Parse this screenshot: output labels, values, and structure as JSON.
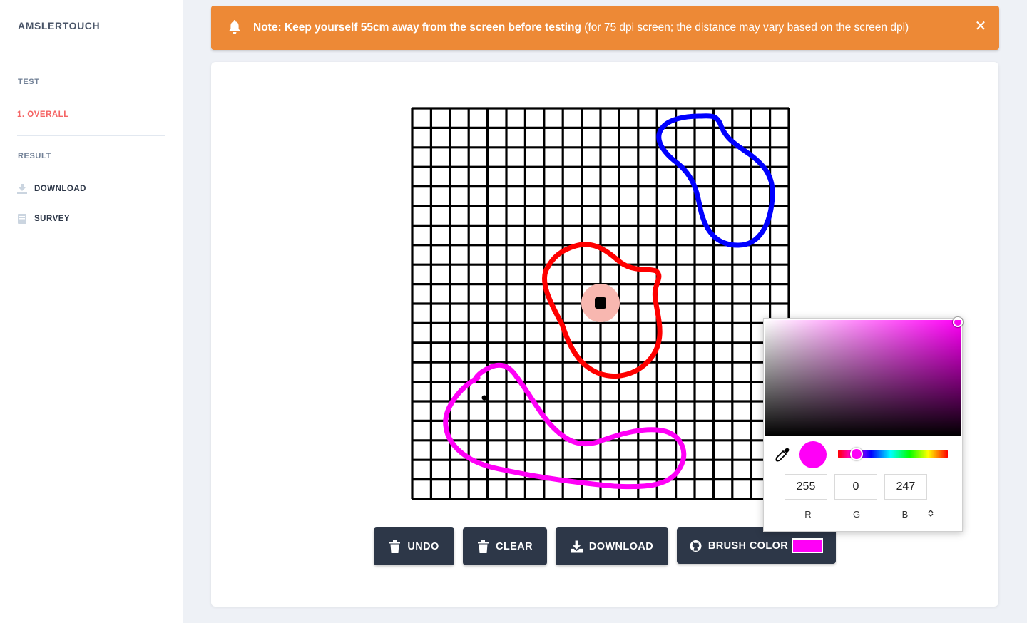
{
  "sidebar": {
    "brand": "AMSLERTOUCH",
    "test_label": "TEST",
    "overall_item": "1. OVERALL",
    "result_label": "RESULT",
    "download_item": "DOWNLOAD",
    "survey_item": "SURVEY"
  },
  "alert": {
    "strong_text": "Note: Keep yourself 55cm away from the screen before testing",
    "detail_text": " (for 75 dpi screen; the distance may vary based on the screen dpi)",
    "close_symbol": "✕",
    "color": "#ed8936",
    "icon": "bell-icon"
  },
  "toolbar": {
    "undo_label": "UNDO",
    "clear_label": "CLEAR",
    "download_label": "DOWNLOAD",
    "brush_label": "BRUSH COLOR",
    "brush_color": "#ff00f7"
  },
  "color_picker": {
    "r": "255",
    "g": "0",
    "b": "247",
    "r_label": "R",
    "g_label": "G",
    "b_label": "B",
    "toggle_symbol": "⌃⌄",
    "current_color": "#ff00f7"
  },
  "amsler_grid": {
    "cells": 20,
    "line_color": "#000000",
    "fixation_dot_color": "#000000",
    "fixation_halo_color": "#f8b7b0",
    "strokes": [
      {
        "color": "#ff0000",
        "label": "red-distortion-outline"
      },
      {
        "color": "#0000ff",
        "label": "blue-distortion-outline"
      },
      {
        "color": "#ff00f7",
        "label": "magenta-distortion-outline"
      }
    ]
  },
  "colors": {
    "accent": "#f56565",
    "button_bg": "#2d3748",
    "page_bg": "#eef1f6"
  }
}
